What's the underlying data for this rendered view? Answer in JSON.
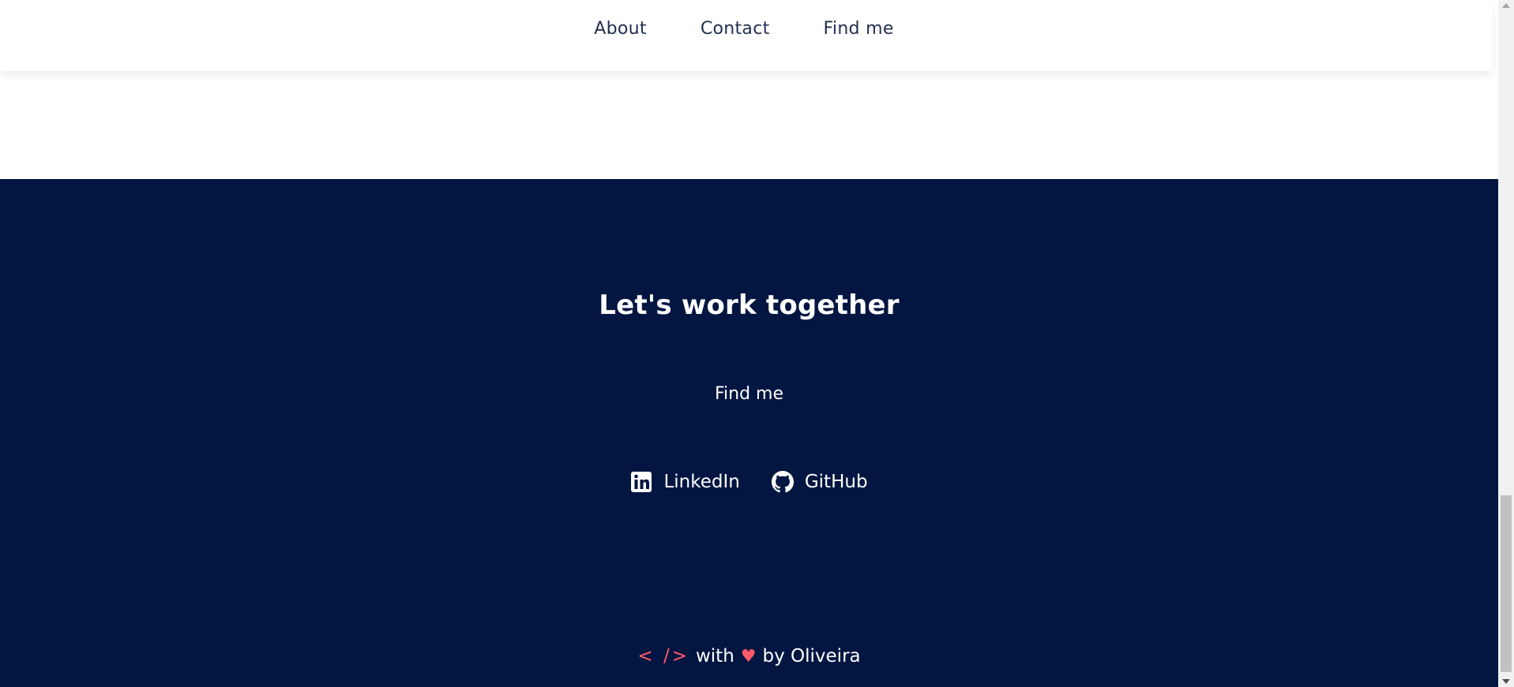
{
  "nav": {
    "links": [
      {
        "label": "About"
      },
      {
        "label": "Contact"
      },
      {
        "label": "Find me"
      }
    ]
  },
  "footer": {
    "headline": "Let's work together",
    "subheading": "Find me",
    "social": [
      {
        "label": "LinkedIn",
        "icon": "linkedin-icon"
      },
      {
        "label": "GitHub",
        "icon": "github-icon"
      }
    ],
    "credit": {
      "code_glyph": "< />",
      "with": "with",
      "heart": "♥",
      "by": "by Oliveira"
    }
  },
  "colors": {
    "footer_background": "#031641",
    "accent": "#ff5a6a",
    "nav_text": "#22304f"
  }
}
